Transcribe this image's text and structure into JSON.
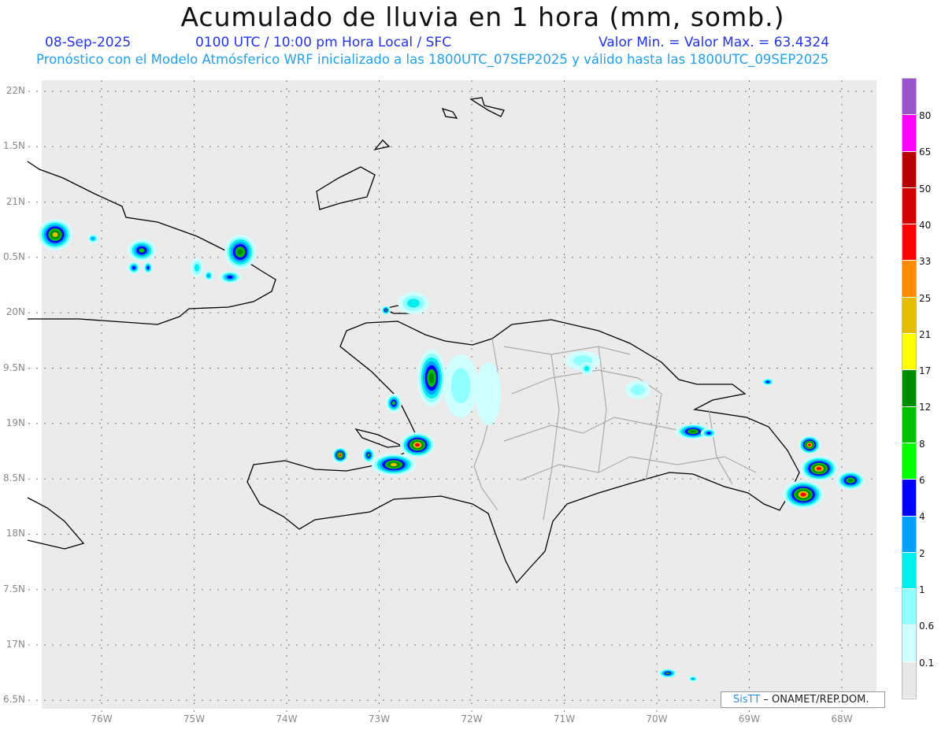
{
  "header": {
    "title": "Acumulado de lluvia en 1 hora (mm, somb.)",
    "date": "08-Sep-2025",
    "time": "0100 UTC / 10:00 pm Hora Local / SFC",
    "minmax": "Valor Min. =   Valor Max. = 63.4324",
    "subtitle": "Pronóstico con el Modelo Atmósferico WRF inicializado a las 1800UTC_07SEP2025 y válido hasta las  1800UTC_09SEP2025"
  },
  "axes": {
    "lat_labels": [
      "22N",
      "1.5N",
      "21N",
      "0.5N",
      "20N",
      "9.5N",
      "19N",
      "8.5N",
      "18N",
      "7.5N",
      "17N",
      "6.5N"
    ],
    "lon_labels": [
      "76W",
      "75W",
      "74W",
      "73W",
      "72W",
      "71W",
      "70W",
      "69W",
      "68W"
    ]
  },
  "colorbar": {
    "colors": [
      "#9955cc",
      "#ff00ff",
      "#b40000",
      "#d20000",
      "#ff0000",
      "#ff8c00",
      "#e6be00",
      "#ffff00",
      "#008c00",
      "#00c000",
      "#00ff00",
      "#0000ff",
      "#00a0ff",
      "#00eeee",
      "#90ffff",
      "#d0ffff",
      "#e8e8e8"
    ],
    "labels": [
      "80",
      "65",
      "50",
      "40",
      "33",
      "25",
      "21",
      "17",
      "12",
      "8",
      "6",
      "4",
      "2",
      "1",
      "0.6",
      "0.1"
    ]
  },
  "credit": {
    "brand": "SisTT",
    "text": " –  ONAMET/REP.DOM."
  },
  "colors": {
    "ocean": "#ebebeb",
    "land_line": "#000000",
    "province_line": "#aaaaaa"
  }
}
